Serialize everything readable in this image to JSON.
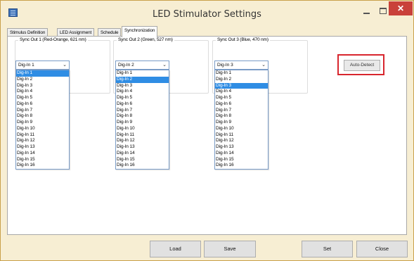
{
  "window": {
    "title": "LED Stimulator Settings"
  },
  "tabs": [
    {
      "label": "Stimulus Definition"
    },
    {
      "label": "LED Assignment"
    },
    {
      "label": "Schedule"
    },
    {
      "label": "Synchronization"
    }
  ],
  "sync_groups": [
    {
      "label": "Sync Out 1 (Red-Orange, 621 nm)",
      "selected": "Dig-In 1",
      "highlighted_index": 0
    },
    {
      "label": "Sync Out 2 (Green, 527 nm)",
      "selected": "Dig-In 2",
      "highlighted_index": 1
    },
    {
      "label": "Sync Out 3 (Blue, 470 nm)",
      "selected": "Dig-In 3",
      "highlighted_index": 2
    }
  ],
  "options": [
    "Dig-In 1",
    "Dig-In 2",
    "Dig-In 3",
    "Dig-In 4",
    "Dig-In 5",
    "Dig-In 6",
    "Dig-In 7",
    "Dig-In 8",
    "Dig-In 9",
    "Dig-In 10",
    "Dig-In 11",
    "Dig-In 12",
    "Dig-In 13",
    "Dig-In 14",
    "Dig-In 15",
    "Dig-In 16"
  ],
  "buttons": {
    "auto_detect": "Auto-Detect",
    "load": "Load",
    "save": "Save",
    "set": "Set",
    "close": "Close"
  },
  "colors": {
    "highlight": "#2f8de4",
    "annotation": "#d8262e",
    "close": "#c9413a"
  }
}
